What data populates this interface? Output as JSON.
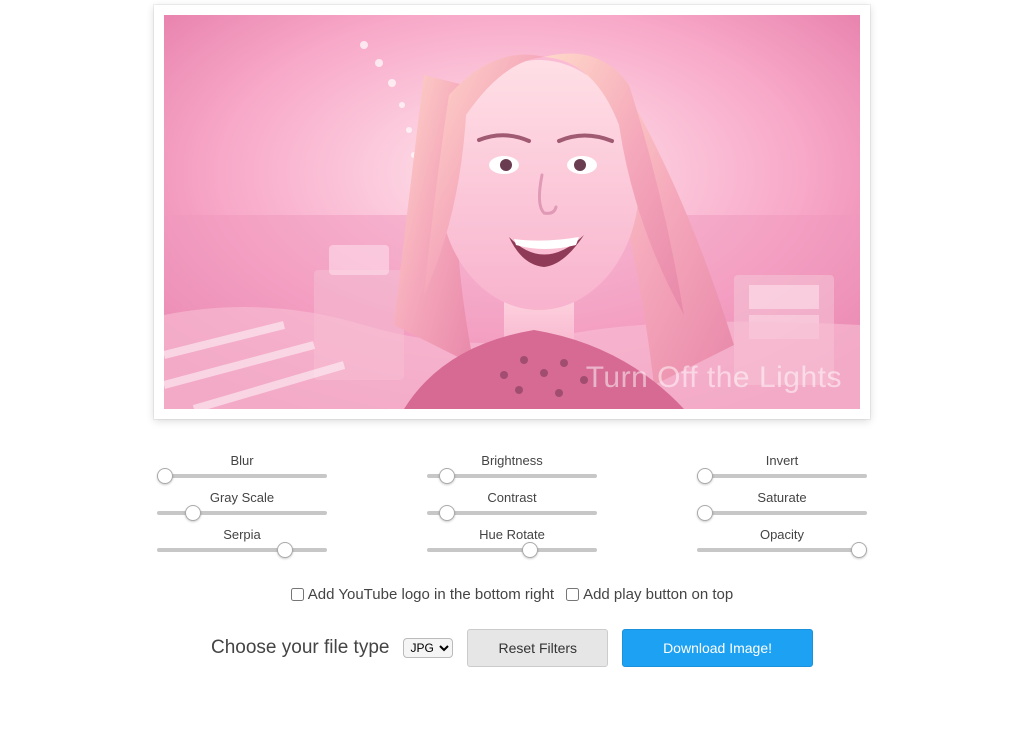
{
  "preview": {
    "watermark": "Turn Off the Lights"
  },
  "sliders": {
    "blur": {
      "label": "Blur",
      "value": 0,
      "min": 0,
      "max": 100
    },
    "brightness": {
      "label": "Brightness",
      "value": 8,
      "min": 0,
      "max": 100
    },
    "invert": {
      "label": "Invert",
      "value": 0,
      "min": 0,
      "max": 100
    },
    "grayscale": {
      "label": "Gray Scale",
      "value": 18,
      "min": 0,
      "max": 100
    },
    "contrast": {
      "label": "Contrast",
      "value": 8,
      "min": 0,
      "max": 100
    },
    "saturate": {
      "label": "Saturate",
      "value": 0,
      "min": 0,
      "max": 100
    },
    "serpia": {
      "label": "Serpia",
      "value": 78,
      "min": 0,
      "max": 100
    },
    "huerotate": {
      "label": "Hue Rotate",
      "value": 62,
      "min": 0,
      "max": 100
    },
    "opacity": {
      "label": "Opacity",
      "value": 100,
      "min": 0,
      "max": 100
    }
  },
  "options": {
    "youtube_logo_label": "Add YouTube logo in the bottom right",
    "play_button_label": "Add play button on top"
  },
  "actions": {
    "filetype_label": "Choose your file type",
    "filetype_selected": "JPG",
    "reset_label": "Reset Filters",
    "download_label": "Download Image!"
  }
}
